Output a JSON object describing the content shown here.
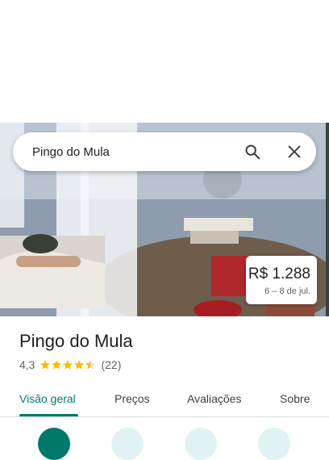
{
  "search": {
    "value": "Pingo do Mula"
  },
  "price_card": {
    "price": "R$ 1.288",
    "dates": "6 – 8 de jul."
  },
  "place": {
    "name": "Pingo do Mula",
    "rating": "4,3",
    "rating_value": 4.3,
    "reviews": "(22)"
  },
  "tabs": [
    {
      "label": "Visão geral",
      "active": true
    },
    {
      "label": "Preços"
    },
    {
      "label": "Avaliações"
    },
    {
      "label": "Sobre"
    }
  ],
  "colors": {
    "accent": "#00796b",
    "star": "#fbbc04"
  },
  "icons": {
    "search": "search-icon",
    "close": "close-icon"
  }
}
